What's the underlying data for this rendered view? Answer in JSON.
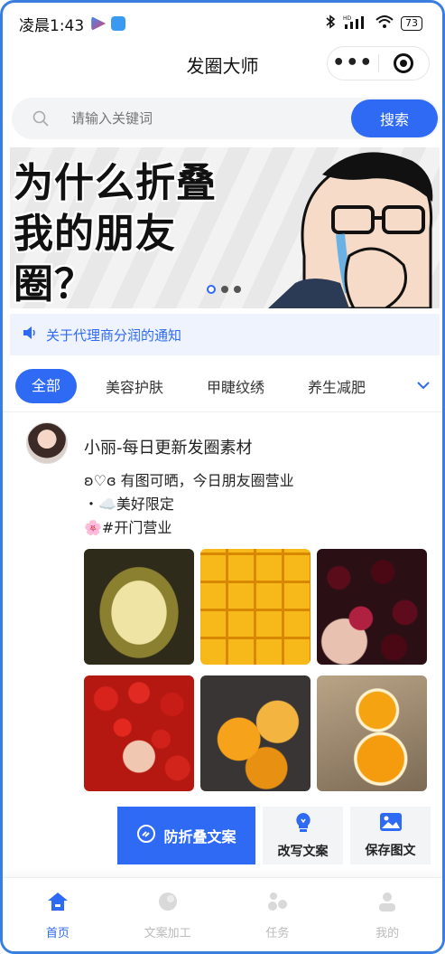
{
  "status_bar": {
    "time": "凌晨1:43",
    "battery": "73",
    "network": "HD"
  },
  "header": {
    "title": "发圈大师",
    "more_label": "•••"
  },
  "search": {
    "placeholder": "请输入关键词",
    "button_label": "搜索"
  },
  "banner": {
    "lines": [
      "为什么折叠",
      "我的朋友",
      "圈？"
    ],
    "slide_count": 3,
    "active_slide": 1
  },
  "notice": {
    "text": "关于代理商分润的通知"
  },
  "categories": {
    "items": [
      "全部",
      "美容护肤",
      "甲睫纹绣",
      "养生减肥"
    ],
    "active_index": 0
  },
  "post": {
    "author": "小丽-每日更新发圈素材",
    "lines": [
      "ʚ♡ɞ 有图可晒，今日朋友圈营业",
      "・☁️美好限定",
      "🌸#开门营业"
    ],
    "photos": [
      "durian",
      "mango",
      "cherry",
      "tomato",
      "orange",
      "orange-halves"
    ]
  },
  "actions": {
    "primary_label": "防折叠文案",
    "rewrite_label": "改写文案",
    "save_label": "保存图文"
  },
  "tabbar": {
    "items": [
      "首页",
      "文案加工",
      "任务",
      "我的"
    ],
    "active_index": 0
  },
  "colors": {
    "accent": "#2f6af5",
    "notice_bg": "#eef3fd"
  }
}
